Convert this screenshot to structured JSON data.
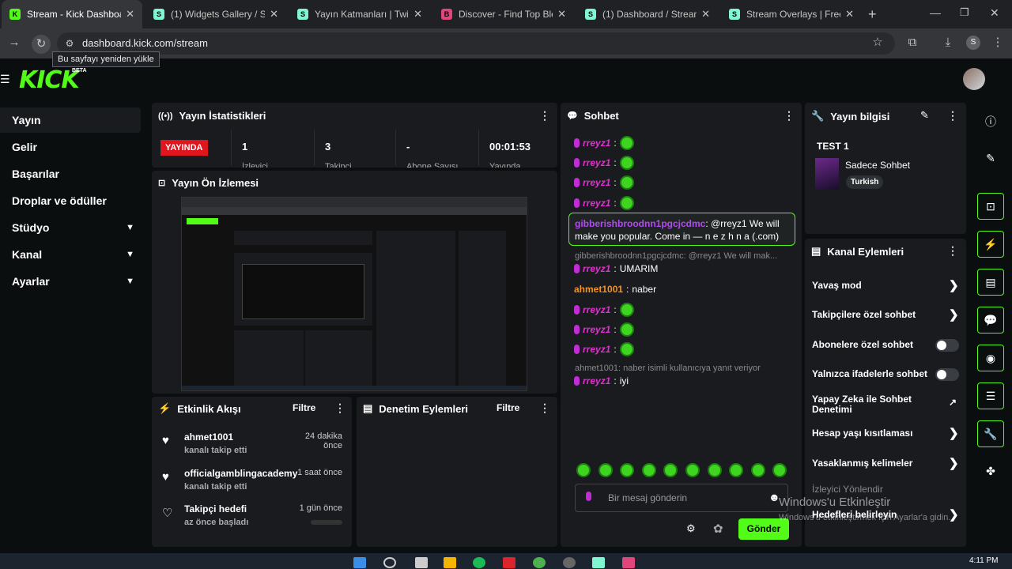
{
  "browser": {
    "tabs": [
      {
        "title": "Stream - Kick Dashboard",
        "fav": "K",
        "color": "#53fc18",
        "active": true
      },
      {
        "title": "(1) Widgets Gallery / Strea",
        "fav": "S",
        "color": "#80f5d2"
      },
      {
        "title": "Yayın Katmanları | Twitch, T",
        "fav": "S",
        "color": "#80f5d2"
      },
      {
        "title": "Discover - Find Top Blerps",
        "fav": "B",
        "color": "#e0457b"
      },
      {
        "title": "(1) Dashboard / Streamlab",
        "fav": "S",
        "color": "#80f5d2"
      },
      {
        "title": "Stream Overlays | Free & P",
        "fav": "S",
        "color": "#80f5d2"
      }
    ],
    "url": "dashboard.kick.com/stream",
    "reload_tooltip": "Bu sayfayı yeniden yükle",
    "profile_initial": "S"
  },
  "logo": {
    "text": "KICK",
    "badge": "BETA"
  },
  "sidebar": {
    "items": [
      {
        "label": "Yayın",
        "selected": true
      },
      {
        "label": "Gelir"
      },
      {
        "label": "Başarılar"
      },
      {
        "label": "Droplar ve ödüller"
      },
      {
        "label": "Stüdyo",
        "expandable": true
      },
      {
        "label": "Kanal",
        "expandable": true
      },
      {
        "label": "Ayarlar",
        "expandable": true
      }
    ]
  },
  "stats": {
    "title": "Yayın İstatistikleri",
    "live_badge": "YAYINDA",
    "values": [
      "1",
      "3",
      "-",
      "00:01:53"
    ],
    "labels": [
      "İzleyici",
      "Takipçi",
      "Abone Sayısı",
      "Yayında"
    ]
  },
  "preview": {
    "title": "Yayın Ön İzlemesi"
  },
  "activity": {
    "title": "Etkinlik Akışı",
    "filter": "Filtre",
    "items": [
      {
        "name": "ahmet1001",
        "time": "24 dakika önce",
        "sub": "kanalı takip etti"
      },
      {
        "name": "officialgamblingacademy",
        "time": "1 saat önce",
        "sub": "kanalı takip etti"
      },
      {
        "name": "Takipçi hedefi",
        "time": "1 gün önce",
        "sub": "az önce başladı"
      }
    ]
  },
  "moderation": {
    "title": "Denetim Eylemleri",
    "filter": "Filtre"
  },
  "chat": {
    "title": "Sohbet",
    "user": "rreyz1",
    "highlight_user": "gibberishbroodnn1pgcjcdmc",
    "highlight_msg": "@rreyz1 We will make you popular. Come in — n e z h n a (.com)",
    "reply_preview": "gibberishbroodnn1pgcjcdmc: @rreyz1 We will mak...",
    "umarim": "UMARIM",
    "other_user": "ahmet1001",
    "other_msg": "naber",
    "reply_preview2": "ahmet1001: naber isimli kullanıcıya yanıt veriyor",
    "last_msg": "iyi",
    "input_placeholder": "Bir mesaj gönderin",
    "send": "Gönder",
    "colors": {
      "accent": "#53fc18",
      "user": "#e32ed2",
      "other": "#f7931e"
    }
  },
  "info": {
    "title": "Yayın bilgisi",
    "stream_title": "TEST 1",
    "category": "Sadece Sohbet",
    "tag": "Turkish"
  },
  "channel_actions": {
    "title": "Kanal Eylemleri",
    "items": [
      {
        "label": "Yavaş mod",
        "ctl": "arrow"
      },
      {
        "label": "Takipçilere özel sohbet",
        "ctl": "arrow"
      },
      {
        "label": "Abonelere özel sohbet",
        "ctl": "toggle"
      },
      {
        "label": "Yalnızca ifadelerle sohbet",
        "ctl": "toggle"
      },
      {
        "label": "Yapay Zeka ile Sohbet Denetimi",
        "ctl": "ext"
      },
      {
        "label": "Hesap yaşı kısıtlaması",
        "ctl": "arrow"
      },
      {
        "label": "Yasaklanmış kelimeler",
        "ctl": "arrow"
      },
      {
        "label": "İzleyici Yönlendir",
        "ctl": "none"
      },
      {
        "label": "Hedefleri belirleyin",
        "ctl": "arrow"
      }
    ]
  },
  "watermark": {
    "line1": "Windows'u Etkinleştir",
    "line2": "Windows'u etkinleştirmek için Ayarlar'a gidin."
  },
  "clock": {
    "time": "4:11 PM"
  }
}
